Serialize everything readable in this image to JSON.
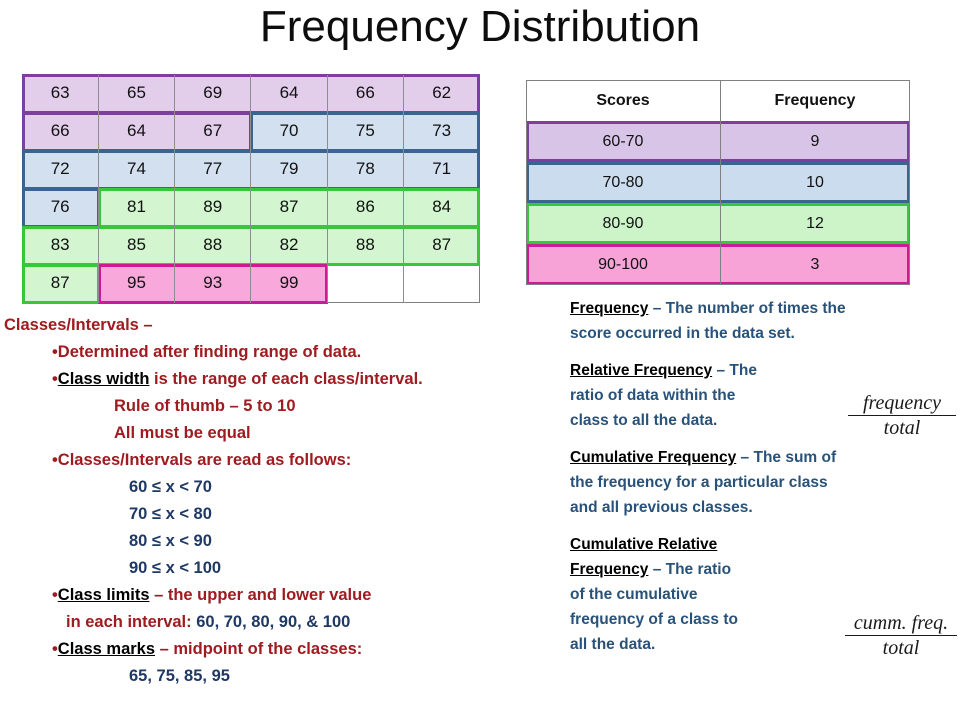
{
  "title": "Frequency Distribution",
  "data_grid": {
    "rows": [
      [
        "63",
        "65",
        "69",
        "64",
        "66",
        "62"
      ],
      [
        "66",
        "64",
        "67",
        "70",
        "75",
        "73"
      ],
      [
        "72",
        "74",
        "77",
        "79",
        "78",
        "71"
      ],
      [
        "76",
        "81",
        "89",
        "87",
        "86",
        "84"
      ],
      [
        "83",
        "85",
        "88",
        "82",
        "88",
        "87"
      ],
      [
        "87",
        "95",
        "93",
        "99",
        "",
        ""
      ]
    ],
    "group_colors": {
      "class_60_70": "#7b3fa0",
      "class_70_80": "#3a6591",
      "class_80_90": "#38c63a",
      "class_90_100": "#cc1c95"
    }
  },
  "freq_table": {
    "headers": [
      "Scores",
      "Frequency"
    ],
    "rows": [
      {
        "scores": "60-70",
        "frequency": "9"
      },
      {
        "scores": "70-80",
        "frequency": "10"
      },
      {
        "scores": "80-90",
        "frequency": "12"
      },
      {
        "scores": "90-100",
        "frequency": "3"
      }
    ]
  },
  "left_notes": {
    "heading": "Classes/Intervals –",
    "b1": "•Determined after finding range of data.",
    "b2_bullet": "•",
    "b2_term": "Class width",
    "b2_rest": " is the range of each class/interval.",
    "b2_sub1": "Rule of thumb – 5 to 10",
    "b2_sub2": "All must be equal",
    "b3": "•Classes/Intervals are read as follows:",
    "intervals": [
      "60 ≤ x < 70",
      "70 ≤ x < 80",
      "80 ≤ x < 90",
      "90 ≤ x < 100"
    ],
    "b4_bullet": "•",
    "b4_term": "Class limits",
    "b4_rest": " – the upper and lower value",
    "b4_line2_red": "in each interval: ",
    "b4_line2_navy": "60, 70, 80, 90, & 100",
    "b5_bullet": "•",
    "b5_term": "Class marks",
    "b5_rest": " – midpoint of the classes:",
    "b5_values": "65, 75, 85, 95"
  },
  "right_notes": {
    "p1_term": "Frequency",
    "p1_l1": " – The number of times the",
    "p1_l2": "score occurred in the data set.",
    "p2_term": "Relative Frequency",
    "p2_l1": " – The",
    "p2_l2": "ratio of data within the",
    "p2_l3": "class to all the data.",
    "p3_term": "Cumulative Frequency",
    "p3_l1": " – The sum of",
    "p3_l2": "the frequency for a particular class",
    "p3_l3": "and all previous classes.",
    "p4_term_l1": "Cumulative Relative",
    "p4_term_l2": "Frequency",
    "p4_l1": " – The ratio",
    "p4_l2": "of the cumulative",
    "p4_l3": "frequency of a class to",
    "p4_l4": "all the data."
  },
  "formulas": {
    "f1_num": "frequency",
    "f1_den": "total",
    "f2_num": "cumm. freq.",
    "f2_den": "total"
  }
}
